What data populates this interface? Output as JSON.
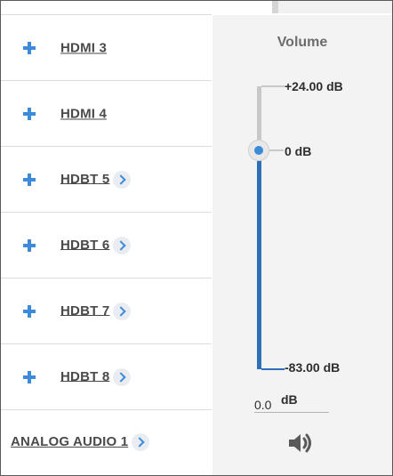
{
  "inputs": [
    {
      "label": "HDMI 3",
      "has_chevron": false
    },
    {
      "label": "HDMI 4",
      "has_chevron": false
    },
    {
      "label": "HDBT 5",
      "has_chevron": true
    },
    {
      "label": "HDBT 6",
      "has_chevron": true
    },
    {
      "label": "HDBT 7",
      "has_chevron": true
    },
    {
      "label": "HDBT 8",
      "has_chevron": true
    },
    {
      "label": "ANALOG AUDIO 1",
      "has_chevron": true
    }
  ],
  "volume": {
    "title": "Volume",
    "max_label": "+24.00 dB",
    "zero_label": "0 dB",
    "min_label": "-83.00 dB",
    "value": "0.0",
    "unit": "dB",
    "speaker_icon": "speaker-icon"
  },
  "colors": {
    "accent": "#3c8ad8",
    "track_fill": "#2f6fb7",
    "track_empty": "#c8c8c8",
    "panel_bg": "#f3f3f3"
  }
}
